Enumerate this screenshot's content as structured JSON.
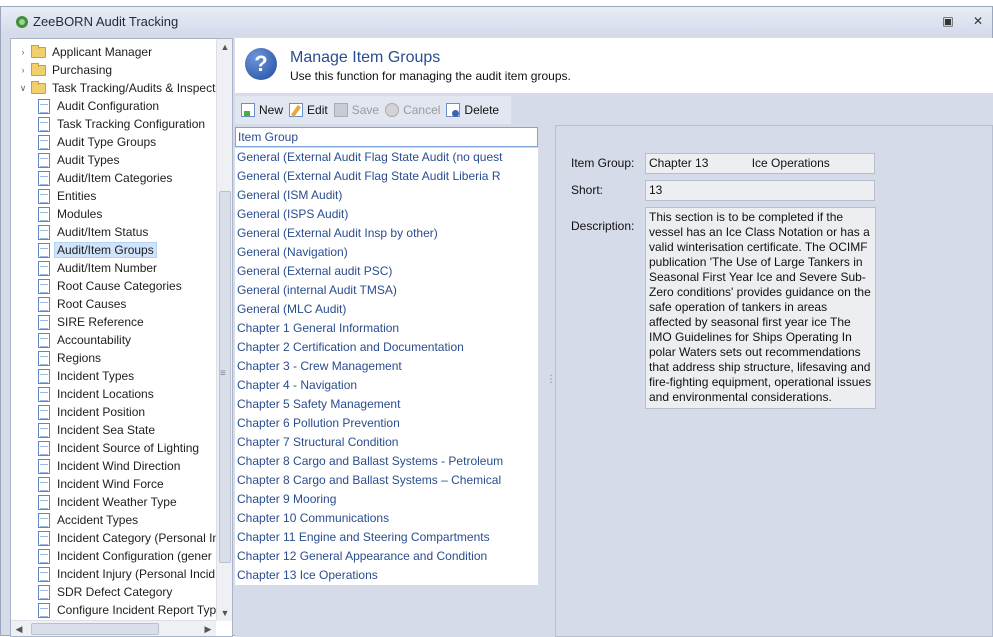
{
  "window": {
    "title": "ZeeBORN Audit Tracking"
  },
  "tree": {
    "items": [
      {
        "label": "Applicant Manager",
        "type": "folder",
        "level": 0,
        "expanded": false
      },
      {
        "label": "Purchasing",
        "type": "folder",
        "level": 0,
        "expanded": false
      },
      {
        "label": "Task Tracking/Audits & Inspect",
        "type": "folder",
        "level": 0,
        "expanded": true
      },
      {
        "label": "Audit Configuration",
        "type": "doc",
        "level": 1
      },
      {
        "label": "Task Tracking Configuration",
        "type": "doc",
        "level": 1
      },
      {
        "label": "Audit Type Groups",
        "type": "doc",
        "level": 1
      },
      {
        "label": "Audit Types",
        "type": "doc",
        "level": 1
      },
      {
        "label": "Audit/Item Categories",
        "type": "doc",
        "level": 1
      },
      {
        "label": "Entities",
        "type": "doc",
        "level": 1
      },
      {
        "label": "Modules",
        "type": "doc",
        "level": 1
      },
      {
        "label": "Audit/Item Status",
        "type": "doc",
        "level": 1
      },
      {
        "label": "Audit/Item Groups",
        "type": "doc",
        "level": 1,
        "selected": true
      },
      {
        "label": "Audit/Item Number",
        "type": "doc",
        "level": 1
      },
      {
        "label": "Root Cause Categories",
        "type": "doc",
        "level": 1
      },
      {
        "label": "Root Causes",
        "type": "doc",
        "level": 1
      },
      {
        "label": "SIRE Reference",
        "type": "doc",
        "level": 1
      },
      {
        "label": "Accountability",
        "type": "doc",
        "level": 1
      },
      {
        "label": "Regions",
        "type": "doc",
        "level": 1
      },
      {
        "label": "Incident Types",
        "type": "doc",
        "level": 1
      },
      {
        "label": "Incident Locations",
        "type": "doc",
        "level": 1
      },
      {
        "label": "Incident Position",
        "type": "doc",
        "level": 1
      },
      {
        "label": "Incident Sea State",
        "type": "doc",
        "level": 1
      },
      {
        "label": "Incident Source of Lighting",
        "type": "doc",
        "level": 1
      },
      {
        "label": "Incident Wind Direction",
        "type": "doc",
        "level": 1
      },
      {
        "label": "Incident Wind Force",
        "type": "doc",
        "level": 1
      },
      {
        "label": "Incident Weather Type",
        "type": "doc",
        "level": 1
      },
      {
        "label": "Accident Types",
        "type": "doc",
        "level": 1
      },
      {
        "label": "Incident Category (Personal In",
        "type": "doc",
        "level": 1
      },
      {
        "label": "Incident Configuration (gener",
        "type": "doc",
        "level": 1
      },
      {
        "label": "Incident Injury (Personal Incid",
        "type": "doc",
        "level": 1
      },
      {
        "label": "SDR Defect Category",
        "type": "doc",
        "level": 1
      },
      {
        "label": "Configure Incident Report Typ",
        "type": "doc",
        "level": 1
      }
    ]
  },
  "header": {
    "title": "Manage Item Groups",
    "subtitle": "Use this function for managing the audit item groups."
  },
  "toolbar": {
    "new_label": "New",
    "edit_label": "Edit",
    "save_label": "Save",
    "cancel_label": "Cancel",
    "delete_label": "Delete"
  },
  "grid": {
    "column": "Item Group",
    "rows": [
      "General (External Audit Flag State Audit (no quest",
      "General (External Audit Flag State Audit Liberia R",
      "General (ISM Audit)",
      "General (ISPS Audit)",
      "General (External Audit Insp by other)",
      "General (Navigation)",
      "General (External audit PSC)",
      "General (internal Audit TMSA)",
      "General (MLC Audit)",
      "Chapter 1 General Information",
      "Chapter 2 Certification and Documentation",
      "Chapter 3 - Crew Management",
      "Chapter 4  -  Navigation",
      "Chapter 5 Safety Management",
      "Chapter 6 Pollution Prevention",
      "Chapter 7 Structural Condition",
      "Chapter 8  Cargo and Ballast Systems - Petroleum",
      "Chapter 8  Cargo and Ballast Systems – Chemical",
      "Chapter 9  Mooring",
      "Chapter 10 Communications",
      "Chapter 11 Engine and Steering Compartments",
      "Chapter 12 General Appearance and Condition",
      "Chapter 13 Ice Operations"
    ]
  },
  "detail": {
    "item_group_label": "Item Group:",
    "item_group_value": "Chapter 13             Ice Operations",
    "short_label": "Short:",
    "short_value": "13",
    "description_label": "Description:",
    "description_value": "This section is to be completed if the vessel has an Ice Class Notation or has a valid winterisation certificate. The OCIMF publication 'The Use of Large Tankers in Seasonal First Year Ice and Severe Sub-Zero conditions' provides guidance on the safe operation of tankers in areas affected by seasonal first year ice The IMO Guidelines for Ships Operating In polar Waters sets out recommendations that address ship structure, lifesaving and fire-fighting equipment, operational issues and environmental considerations."
  }
}
